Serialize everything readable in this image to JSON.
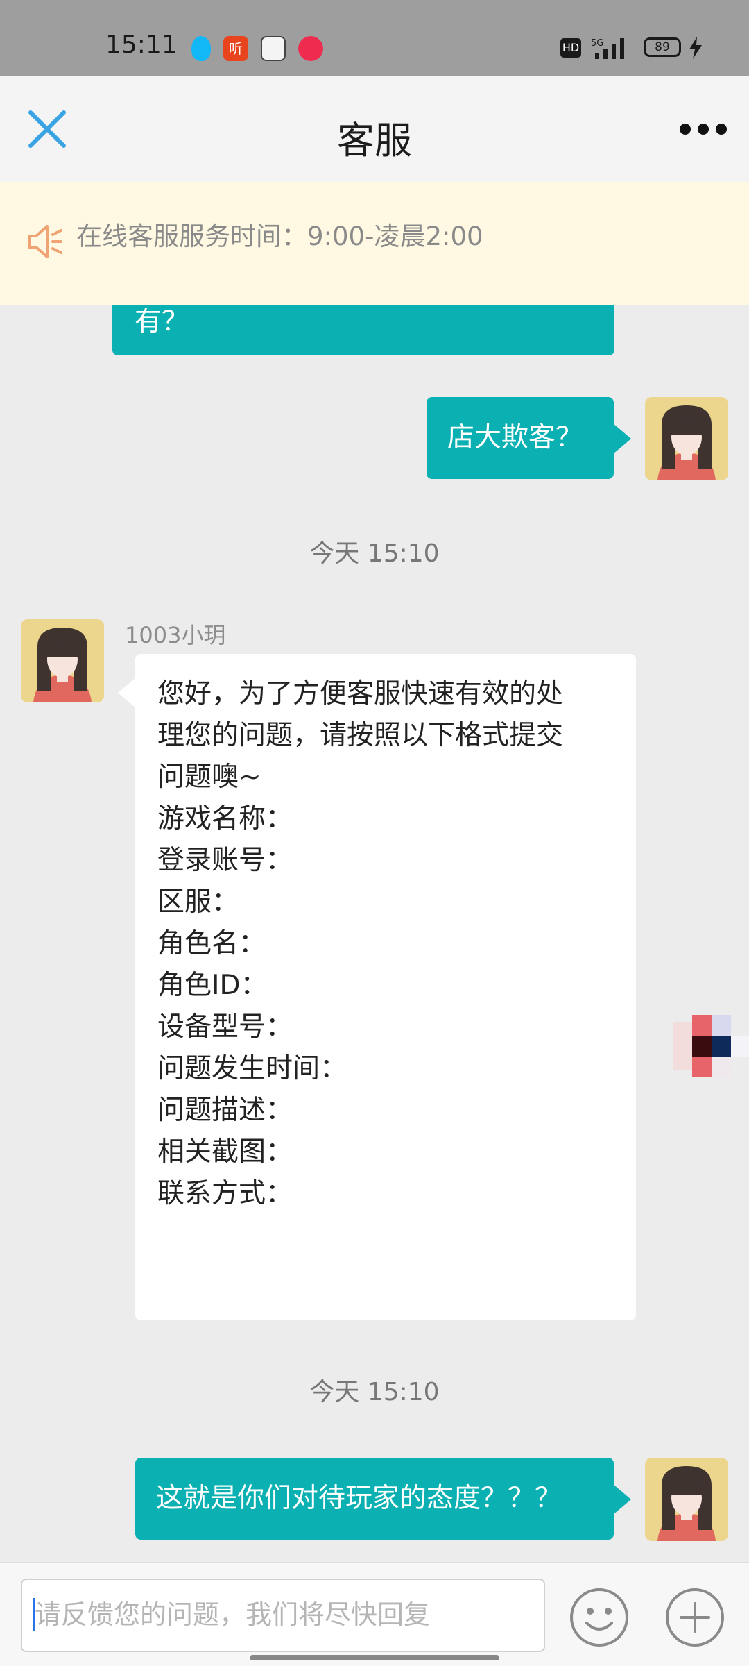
{
  "status_bar": {
    "time": "15:11",
    "app_icons": [
      "qq-icon",
      "ting-icon",
      "shop-icon",
      "pdd-icon"
    ],
    "ting_glyph": "听",
    "hd": "HD",
    "network": "5G",
    "battery": "89",
    "charging": true
  },
  "header": {
    "title": "客服",
    "close_icon": "close-icon",
    "more_icon": "more-icon"
  },
  "notice": {
    "icon": "speaker-icon",
    "text": "在线客服服务时间：9:00-凌晨2:00"
  },
  "messages": [
    {
      "id": "m0",
      "side": "left-partial",
      "text": "有？"
    },
    {
      "id": "m1",
      "side": "right",
      "text": "店大欺客？"
    },
    {
      "id": "t1",
      "type": "timestamp",
      "text": "今天 15:10"
    },
    {
      "id": "m2",
      "side": "left",
      "sender": "1003小玥",
      "lines": [
        "您好，为了方便客服快速有效的处",
        "理您的问题，请按照以下格式提交",
        "问题噢~",
        "游戏名称：",
        "登录账号：",
        "区服：",
        "角色名：",
        "角色ID：",
        "设备型号：",
        "问题发生时间：",
        "问题描述：",
        "相关截图：",
        "联系方式："
      ]
    },
    {
      "id": "t2",
      "type": "timestamp",
      "text": "今天 15:10"
    },
    {
      "id": "m3",
      "side": "right",
      "text": "这就是你们对待玩家的态度？？？"
    }
  ],
  "input_bar": {
    "placeholder": "请反馈您的问题，我们将尽快回复",
    "emoji_icon": "emoji-icon",
    "plus_icon": "plus-icon"
  },
  "colors": {
    "accent_teal": "#0bb0b2",
    "notice_bg": "#fff8e2",
    "close_blue": "#3aa3e3",
    "speaker_orange": "#f0a373"
  }
}
